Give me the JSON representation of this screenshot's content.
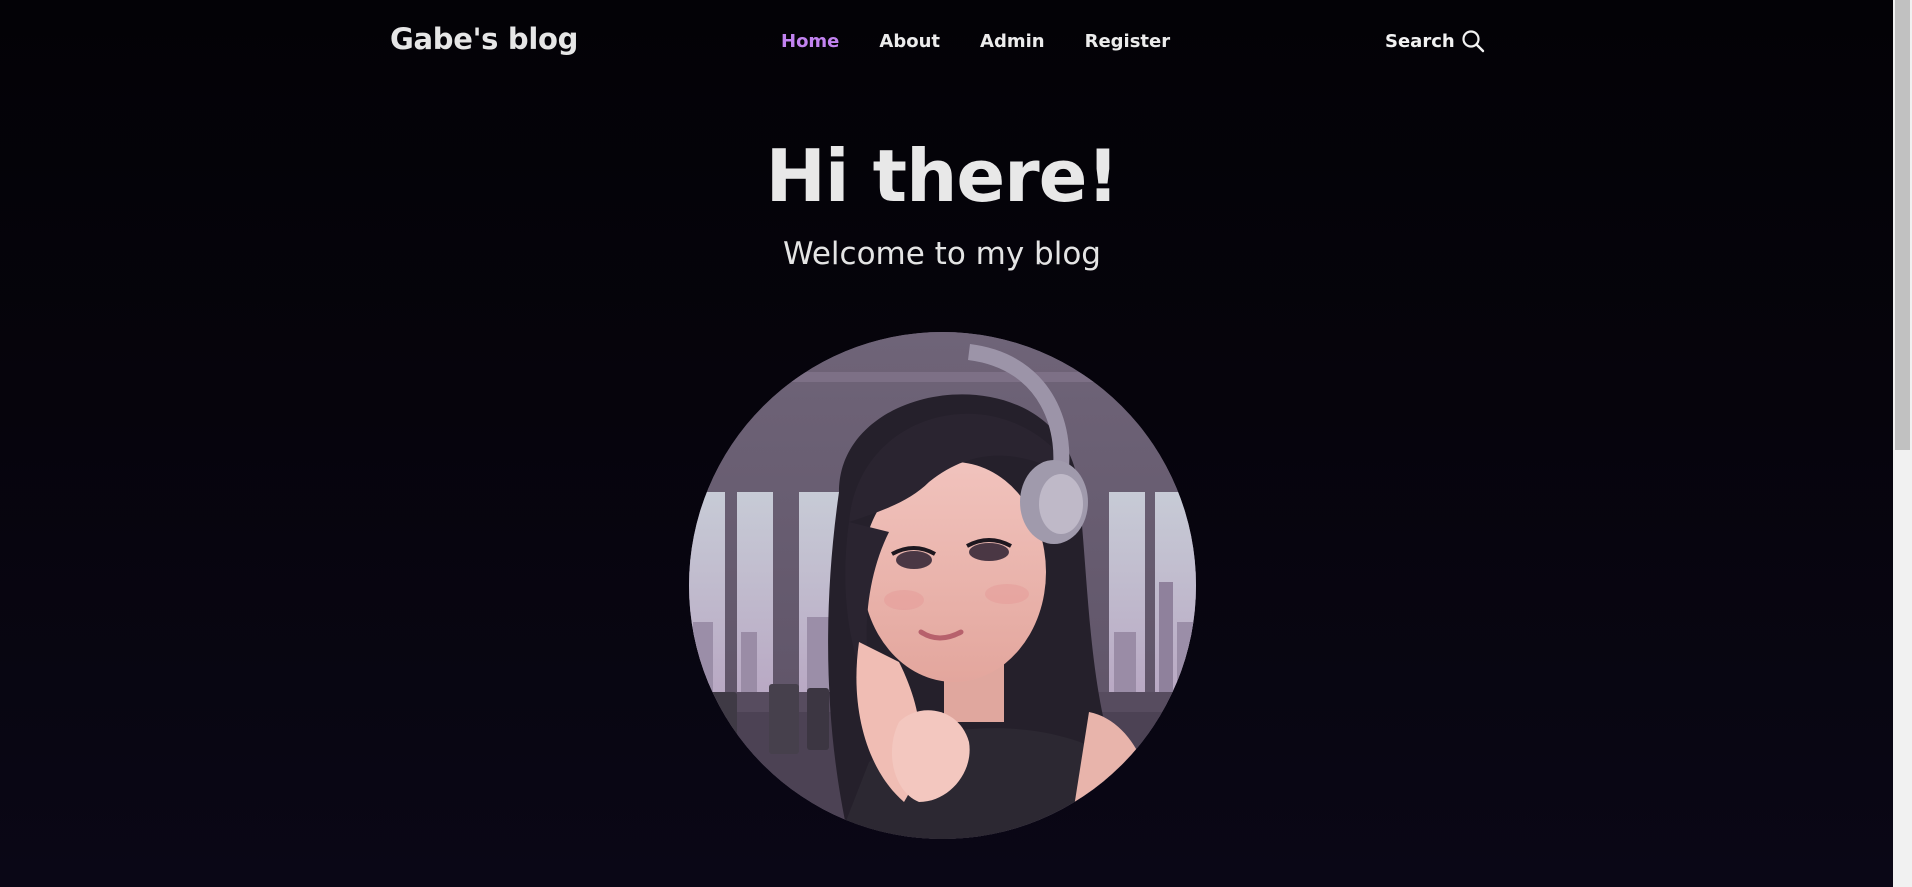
{
  "header": {
    "brand": "Gabe's blog",
    "nav": [
      {
        "label": "Home",
        "active": true
      },
      {
        "label": "About",
        "active": false
      },
      {
        "label": "Admin",
        "active": false
      },
      {
        "label": "Register",
        "active": false
      }
    ],
    "search_label": "Search",
    "search_icon": "search-icon"
  },
  "hero": {
    "title": "Hi there!",
    "subtitle": "Welcome to my blog",
    "avatar_icon": "avatar-illustration"
  },
  "colors": {
    "background": "#030206",
    "text": "#ececec",
    "accent": "#c283f0"
  }
}
